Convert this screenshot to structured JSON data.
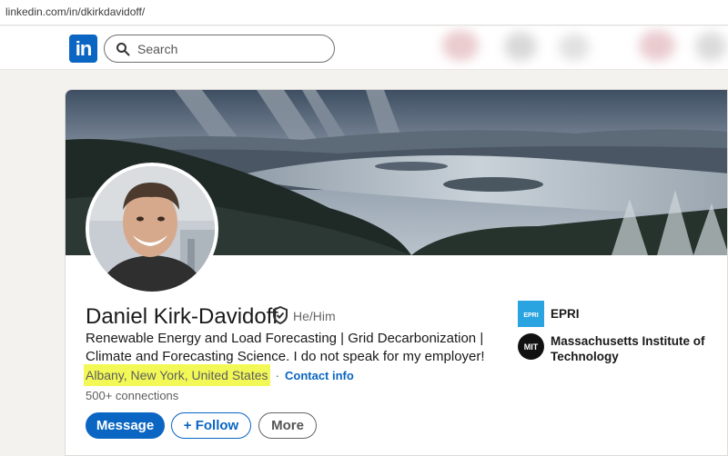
{
  "browser": {
    "url": "linkedin.com/in/dkirkdavidoff/"
  },
  "nav": {
    "logo_text": "in",
    "search_placeholder": "Search"
  },
  "profile": {
    "name": "Daniel Kirk-Davidoff",
    "pronouns": "He/Him",
    "headline": "Renewable Energy and Load Forecasting | Grid Decarbonization | Climate and Forecasting Science. I do not speak for my employer!",
    "location": "Albany, New York, United States",
    "separator": "·",
    "contact_info_label": "Contact info",
    "connections": "500+ connections",
    "location_highlight_color": "#f2f956"
  },
  "actions": {
    "message_label": "Message",
    "follow_label": "+ Follow",
    "more_label": "More"
  },
  "organizations": [
    {
      "name": "EPRI",
      "logo_text": "EPRI",
      "icon": "epri-logo-icon",
      "color": "#2aa3e1"
    },
    {
      "name": "Massachusetts Institute of Technology",
      "logo_text": "MIT",
      "icon": "mit-logo-icon",
      "color": "#111111"
    }
  ],
  "colors": {
    "brand": "#0a66c2",
    "page_bg": "#f4f2ee"
  }
}
